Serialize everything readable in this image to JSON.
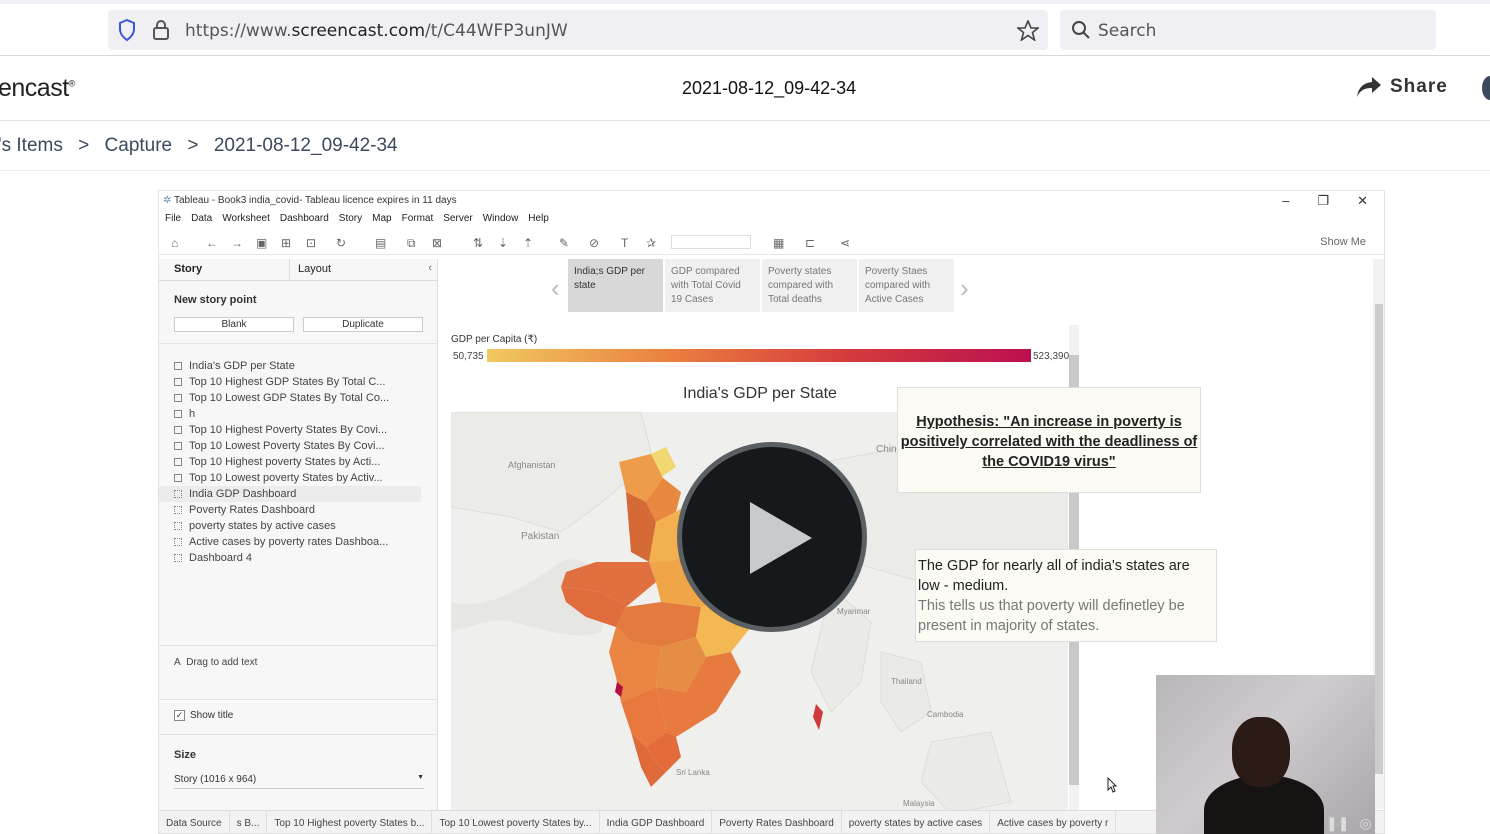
{
  "browser": {
    "url_prefix": "https://www.",
    "url_domain": "screencast.com",
    "url_path": "/t/C44WFP3unJW",
    "search_placeholder": "Search"
  },
  "header": {
    "logo_fragment": "encast",
    "trademark": "®",
    "capture_title": "2021-08-12_09-42-34",
    "share_label": "Share"
  },
  "breadcrumb": {
    "items": [
      "'s Items",
      "Capture",
      "2021-08-12_09-42-34"
    ],
    "separator": ">"
  },
  "tableau": {
    "title": "Tableau - Book3 india_covid- Tableau licence expires in 11 days",
    "window_controls": [
      "–",
      "❐",
      "✕"
    ],
    "menu": [
      "File",
      "Data",
      "Worksheet",
      "Dashboard",
      "Story",
      "Map",
      "Format",
      "Server",
      "Window",
      "Help"
    ],
    "show_me": "Show Me",
    "left_pane": {
      "tabs": [
        "Story",
        "Layout"
      ],
      "new_story_point": "New story point",
      "buttons": [
        "Blank",
        "Duplicate"
      ],
      "sheets": [
        {
          "label": "India's GDP per State",
          "kind": "sheet"
        },
        {
          "label": "Top 10 Highest GDP States By Total C...",
          "kind": "sheet"
        },
        {
          "label": "Top 10 Lowest GDP States By Total Co...",
          "kind": "sheet"
        },
        {
          "label": "h",
          "kind": "sheet"
        },
        {
          "label": "Top 10 Highest Poverty States By Covi...",
          "kind": "sheet"
        },
        {
          "label": "Top 10 Lowest Poverty States By Covi...",
          "kind": "sheet"
        },
        {
          "label": "Top 10 Highest poverty States by Acti...",
          "kind": "sheet"
        },
        {
          "label": "Top 10 Lowest poverty States by Activ...",
          "kind": "sheet"
        },
        {
          "label": "India GDP Dashboard",
          "kind": "dash"
        },
        {
          "label": "Poverty Rates Dashboard",
          "kind": "dash"
        },
        {
          "label": "poverty states by active cases",
          "kind": "dash"
        },
        {
          "label": "Active cases by poverty rates Dashboa...",
          "kind": "dash"
        },
        {
          "label": "Dashboard 4",
          "kind": "dash"
        }
      ],
      "drag_text": "Drag to add text",
      "show_title": "Show title",
      "size_label": "Size",
      "size_value": "Story (1016 x 964)"
    },
    "story_points": [
      {
        "label": "India;s GDP per state",
        "active": true
      },
      {
        "label": "GDP compared with Total Covid 19 Cases",
        "active": false
      },
      {
        "label": "Poverty states compared with Total deaths",
        "active": false
      },
      {
        "label": "Poverty Staes compared with Active Cases",
        "active": false
      }
    ],
    "legend": {
      "title": "GDP per Capita (₹)",
      "min": "50,735",
      "max": "523,390",
      "color_low": "#f0c860",
      "color_high": "#bb1050"
    },
    "map": {
      "title": "India's GDP per State",
      "labels": [
        "Afghanistan",
        "Pakistan",
        "Chin",
        "Myanmar",
        "Thailand",
        "Cambodia",
        "Sri Lanka",
        "Malaysia"
      ]
    },
    "hypothesis": "Hypothesis: \"An increase in poverty is positively correlated with the deadliness of the COVID19 virus\"",
    "note": {
      "line1": "The GDP for nearly all of india's states are low - medium.",
      "line2": "This tells us that poverty will definetley be present in majority of states."
    },
    "bottom_tabs": [
      "Data Source",
      "s B...",
      "Top 10 Highest poverty States b...",
      "Top 10 Lowest poverty States by...",
      "India GDP Dashboard",
      "Poverty Rates Dashboard",
      "poverty states by active cases",
      "Active cases by poverty r"
    ]
  }
}
